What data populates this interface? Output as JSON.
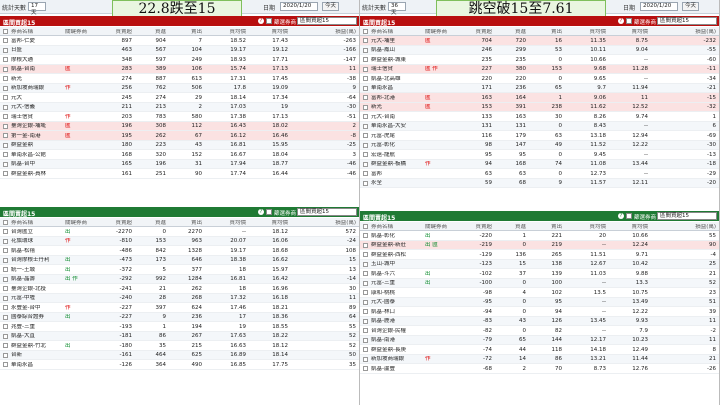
{
  "topbar": {
    "stat_days_label": "統計天數",
    "stat_days_left": "17天",
    "stat_days_right": "36天",
    "date_label": "日期",
    "date": "2020/1/20",
    "today_button": "今天"
  },
  "headings": {
    "left": "22.8跌至15",
    "right": "跳空破15至7.61"
  },
  "colors": {
    "red_header": "#b80f0f",
    "green_header": "#1f7a34",
    "row_highlight": "#fbe2e2"
  },
  "panel_title_red": "區間買超15",
  "panel_title_green": "區間賣超15",
  "panel_setting_label": "篩選券商",
  "panel_select_value": "區間買超15",
  "columns": [
    "券商名稱",
    "關鍵券商",
    "買賣超",
    "買進",
    "賣出",
    "買均價",
    "賣均價",
    "損益(萬)"
  ],
  "left_top": [
    [
      "富邦-仁愛",
      "",
      "897",
      "904",
      "7",
      "18.52",
      "17.43",
      "-263"
    ],
    [
      "日盛",
      "",
      "463",
      "567",
      "104",
      "19.17",
      "19.12",
      "-166"
    ],
    [
      "摩根大通",
      "",
      "348",
      "597",
      "249",
      "18.93",
      "17.71",
      "-147"
    ],
    [
      "凱基-台南",
      "匯",
      "283",
      "389",
      "106",
      "15.74",
      "17.13",
      "11"
    ],
    [
      "新光",
      "",
      "274",
      "887",
      "613",
      "17.31",
      "17.45",
      "-38"
    ],
    [
      "新加坡商瑞銀",
      "作",
      "256",
      "762",
      "506",
      "17.8",
      "19.09",
      "9"
    ],
    [
      "元大",
      "",
      "245",
      "274",
      "29",
      "18.14",
      "17.34",
      "-64"
    ],
    [
      "元大-信義",
      "",
      "211",
      "213",
      "2",
      "17.03",
      "19",
      "-30"
    ],
    [
      "瑞士信貸",
      "作",
      "203",
      "783",
      "580",
      "17.38",
      "17.13",
      "-51"
    ],
    [
      "臺灣企銀-埔墘",
      "匯",
      "196",
      "308",
      "112",
      "16.43",
      "18.02",
      "2"
    ],
    [
      "第一金-南港",
      "匯",
      "195",
      "262",
      "67",
      "16.12",
      "16.46",
      "-8"
    ],
    [
      "群益金鼎",
      "",
      "180",
      "223",
      "43",
      "16.81",
      "15.95",
      "-25"
    ],
    [
      "華南永昌-公館",
      "",
      "168",
      "320",
      "152",
      "16.67",
      "18.04",
      "3"
    ],
    [
      "凱基-台中",
      "",
      "165",
      "196",
      "31",
      "17.94",
      "18.77",
      "-46"
    ],
    [
      "群益金鼎-員林",
      "",
      "161",
      "251",
      "90",
      "17.74",
      "16.44",
      "-46"
    ]
  ],
  "left_bottom": [
    [
      "台灣匯立",
      "出",
      "-2270",
      "0",
      "2270",
      "--",
      "18.12",
      "572"
    ],
    [
      "花旗環球",
      "作",
      "-810",
      "153",
      "963",
      "20.07",
      "16.06",
      "-24"
    ],
    [
      "凱基-松禧",
      "",
      "-486",
      "842",
      "1328",
      "19.17",
      "18.68",
      "108"
    ],
    [
      "台灣摩根士丹利",
      "出",
      "-473",
      "173",
      "646",
      "18.38",
      "16.62",
      "15"
    ],
    [
      "統一-土城",
      "出",
      "-372",
      "5",
      "377",
      "18",
      "15.97",
      "13"
    ],
    [
      "凱基-晶壽",
      "出 作",
      "-292",
      "992",
      "1284",
      "16.81",
      "16.42",
      "-14"
    ],
    [
      "臺灣企銀-北投",
      "",
      "-241",
      "21",
      "262",
      "18",
      "16.96",
      "30"
    ],
    [
      "元富-中壢",
      "",
      "-240",
      "28",
      "268",
      "17.32",
      "16.18",
      "11"
    ],
    [
      "永豐金-台中",
      "作",
      "-227",
      "397",
      "624",
      "17.46",
      "18.21",
      "89"
    ],
    [
      "國泰綜合證券",
      "出",
      "-227",
      "9",
      "236",
      "17",
      "18.36",
      "64"
    ],
    [
      "兆豐-三重",
      "",
      "-193",
      "1",
      "194",
      "19",
      "18.55",
      "55"
    ],
    [
      "凱基-大直",
      "",
      "-181",
      "86",
      "267",
      "17.63",
      "18.22",
      "52"
    ],
    [
      "群益金鼎-竹北",
      "出",
      "-180",
      "35",
      "215",
      "16.63",
      "18.12",
      "52"
    ],
    [
      "台新",
      "",
      "-161",
      "464",
      "625",
      "16.89",
      "18.14",
      "50"
    ],
    [
      "華南永昌",
      "",
      "-126",
      "364",
      "490",
      "16.85",
      "17.75",
      "35"
    ]
  ],
  "right_top": [
    [
      "元大-埔里",
      "匯",
      "704",
      "720",
      "16",
      "11.35",
      "8.75",
      "-232"
    ],
    [
      "凱基-鳳山",
      "",
      "246",
      "299",
      "53",
      "10.11",
      "9.04",
      "-55"
    ],
    [
      "群益金鼎-城東",
      "",
      "235",
      "235",
      "0",
      "10.66",
      "--",
      "-60"
    ],
    [
      "瑞士信貸",
      "匯 作",
      "227",
      "380",
      "153",
      "9.68",
      "11.28",
      "-11"
    ],
    [
      "凱基-北高雄",
      "",
      "220",
      "220",
      "0",
      "9.65",
      "--",
      "-34"
    ],
    [
      "華南永昌",
      "",
      "171",
      "236",
      "65",
      "9.7",
      "11.94",
      "-21"
    ],
    [
      "富邦-北港",
      "匯",
      "163",
      "164",
      "1",
      "9.06",
      "11",
      "-15"
    ],
    [
      "新光",
      "匯",
      "153",
      "391",
      "238",
      "11.62",
      "12.52",
      "-32"
    ],
    [
      "元大-台南",
      "",
      "133",
      "163",
      "30",
      "8.26",
      "9.74",
      "1"
    ],
    [
      "華南永昌-大安",
      "",
      "131",
      "131",
      "0",
      "8.43",
      "--",
      "6"
    ],
    [
      "元富-虎尾",
      "",
      "116",
      "179",
      "63",
      "13.18",
      "12.94",
      "-69"
    ],
    [
      "元富-彰化",
      "",
      "98",
      "147",
      "49",
      "11.52",
      "12.22",
      "-30"
    ],
    [
      "宏遠-龍航",
      "",
      "95",
      "95",
      "0",
      "9.45",
      "--",
      "-13"
    ],
    [
      "群益金鼎-板橋",
      "作",
      "94",
      "168",
      "74",
      "11.08",
      "13.44",
      "-18"
    ],
    [
      "富邦",
      "",
      "63",
      "63",
      "0",
      "12.73",
      "--",
      "-29"
    ],
    [
      "永全",
      "",
      "59",
      "68",
      "9",
      "11.57",
      "12.11",
      "-20"
    ]
  ],
  "right_bottom": [
    [
      "凱基-彰化",
      "出",
      "-220",
      "1",
      "221",
      "20",
      "10.66",
      "55"
    ],
    [
      "群益金鼎-新莊",
      "出 匯",
      "-219",
      "0",
      "219",
      "--",
      "12.24",
      "90"
    ],
    [
      "群益金鼎-西松",
      "",
      "-129",
      "136",
      "265",
      "11.51",
      "9.71",
      "-4"
    ],
    [
      "玉山-城中",
      "",
      "-123",
      "15",
      "138",
      "12.67",
      "10.42",
      "25"
    ],
    [
      "凱基-斗六",
      "出",
      "-102",
      "37",
      "139",
      "11.03",
      "9.88",
      "21"
    ],
    [
      "元富-三重",
      "出",
      "-100",
      "0",
      "100",
      "--",
      "13.3",
      "52"
    ],
    [
      "康和-桃桃",
      "",
      "-98",
      "4",
      "102",
      "13.5",
      "10.75",
      "23"
    ],
    [
      "元大-國泰",
      "",
      "-95",
      "0",
      "95",
      "--",
      "13.49",
      "51"
    ],
    [
      "凱基-林口",
      "",
      "-94",
      "0",
      "94",
      "--",
      "12.22",
      "39"
    ],
    [
      "凱基-鹿港",
      "",
      "-83",
      "43",
      "126",
      "13.45",
      "9.93",
      "11"
    ],
    [
      "台灣企銀-民權",
      "",
      "-82",
      "0",
      "82",
      "--",
      "7.9",
      "-2"
    ],
    [
      "凱基-南港",
      "",
      "-79",
      "65",
      "144",
      "12.17",
      "10.23",
      "11"
    ],
    [
      "群益金鼎-長庚",
      "",
      "-74",
      "44",
      "118",
      "14.18",
      "12.49",
      "8"
    ],
    [
      "新加坡商瑞銀",
      "作",
      "-72",
      "14",
      "86",
      "13.21",
      "11.44",
      "21"
    ],
    [
      "凱基-蘆豐",
      "",
      "-68",
      "2",
      "70",
      "8.73",
      "12.76",
      "-26"
    ]
  ]
}
